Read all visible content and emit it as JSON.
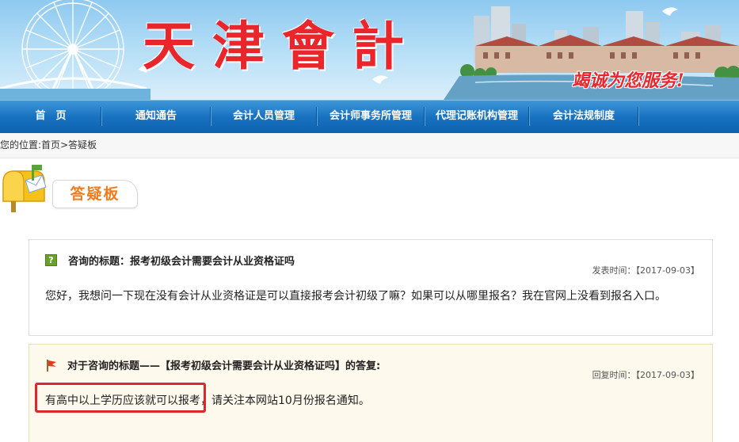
{
  "banner": {
    "title": "天津會計",
    "slogan": "竭诚为您服务!"
  },
  "nav": {
    "items": [
      {
        "label": "首　页"
      },
      {
        "label": "通知通告"
      },
      {
        "label": "会计人员管理"
      },
      {
        "label": "会计师事务所管理"
      },
      {
        "label": "代理记账机构管理"
      },
      {
        "label": "会计法规制度"
      }
    ]
  },
  "breadcrumb": {
    "prefix": "您的位置:",
    "home": "首页",
    "sep": ">",
    "current": "答疑板"
  },
  "page": {
    "heading": "答疑板"
  },
  "question": {
    "title_label": "咨询的标题：",
    "title": "报考初级会计需要会计从业资格证吗",
    "time_label": "发表时间：",
    "time": "【2017-09-03】",
    "body": "您好，我想问一下现在没有会计从业资格证是可以直接报考会计初级了嘛？如果可以从哪里报名？我在官网上没看到报名入口。"
  },
  "answer": {
    "title_prefix": "对于咨询的标题——【报考初级会计需要会计从业资格证吗】的答复:",
    "time_label": "回复时间：",
    "time": "【2017-09-03】",
    "body_highlight": "有高中以上学历应该就可以报考",
    "body_rest": "，请关注本网站10月份报名通知。"
  },
  "colors": {
    "nav_blue": "#1872c0",
    "title_red": "#e8262c",
    "heading_orange": "#ef7d1e",
    "highlight_red": "#e0262c"
  }
}
